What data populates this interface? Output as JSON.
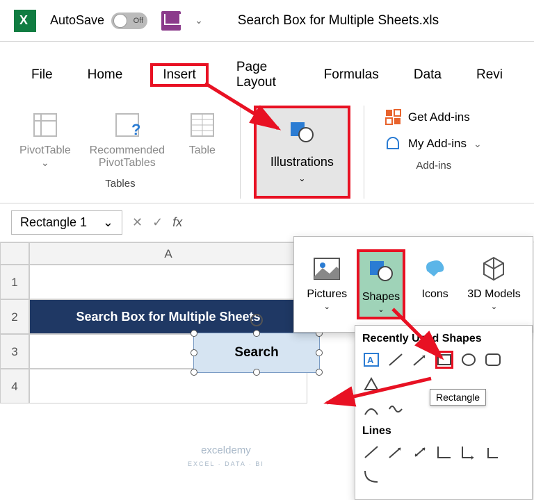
{
  "titlebar": {
    "autosave_label": "AutoSave",
    "toggle_state": "Off",
    "filename": "Search Box for Multiple Sheets.xls"
  },
  "tabs": {
    "file": "File",
    "home": "Home",
    "insert": "Insert",
    "page_layout": "Page Layout",
    "formulas": "Formulas",
    "data": "Data",
    "review": "Revi"
  },
  "ribbon": {
    "pivottable": "PivotTable",
    "recommended": "Recommended PivotTables",
    "table": "Table",
    "tables_group": "Tables",
    "illustrations": "Illustrations",
    "get_addins": "Get Add-ins",
    "my_addins": "My Add-ins",
    "addins_group": "Add-ins"
  },
  "namebox": {
    "value": "Rectangle 1",
    "fx": "fx"
  },
  "grid": {
    "col_a": "A",
    "rows": [
      "1",
      "2",
      "3",
      "4"
    ],
    "title_cell": "Search Box for Multiple Sheets",
    "search_shape": "Search"
  },
  "dropdown": {
    "pictures": "Pictures",
    "shapes": "Shapes",
    "icons": "Icons",
    "models": "3D Models"
  },
  "shapes_panel": {
    "recent_header": "Recently Used Shapes",
    "lines_header": "Lines",
    "tooltip": "Rectangle"
  },
  "watermark": {
    "brand": "exceldemy",
    "sub": "EXCEL · DATA · BI"
  }
}
